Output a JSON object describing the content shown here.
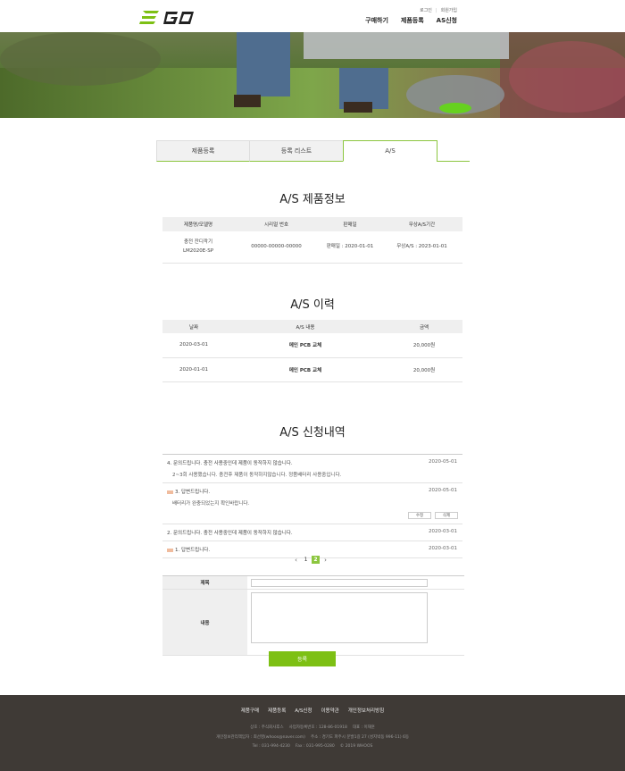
{
  "header": {
    "logo_text": "EGO",
    "util": {
      "login": "로그인",
      "join": "회원가입"
    },
    "nav": [
      "구매하기",
      "제품등록",
      "AS신청"
    ]
  },
  "colors": {
    "accent": "#8cc63f",
    "button": "#7dc014",
    "footer_bg": "#3f3a36"
  },
  "tabs": [
    "제품등록",
    "등록 리스트",
    "A/S"
  ],
  "product_info": {
    "title": "A/S 제품정보",
    "headers": [
      "제품명/모델명",
      "시리얼 번호",
      "판매일",
      "무상A/S기간"
    ],
    "row": {
      "name": "충전 잔디깍기",
      "model": "LM2020E-SP",
      "serial": "00000-00000-00000",
      "sale_date": "판매일 : 2020-01-01",
      "warranty": "무상A/S : 2023-01-01"
    }
  },
  "history": {
    "title": "A/S 이력",
    "headers": [
      "날짜",
      "A/S 내용",
      "금액"
    ],
    "rows": [
      {
        "date": "2020-03-01",
        "content": "메인 PCB 교체",
        "amount": "20,000원"
      },
      {
        "date": "2020-01-01",
        "content": "메인 PCB 교체",
        "amount": "20,000원"
      }
    ]
  },
  "requests": {
    "title": "A/S 신청내역",
    "items": [
      {
        "title": "4. 문의드립니다. 충전 사용중인데 제품이 동작하지 않습니다.",
        "date": "2020-05-01",
        "body": "2~3회 사용했습니다. 충전후 제품이 동작하지않습니다. 정품배터리 사용중입니다."
      },
      {
        "title": "3. 답변드립니다.",
        "date": "2020-05-01",
        "body": "배터리가 완충되었는지 확인바랍니다.",
        "edit": "수정",
        "delete": "삭제"
      },
      {
        "title": "2. 문의드립니다. 충전 사용중인데 제품이 동작하지 않습니다.",
        "date": "2020-03-01"
      },
      {
        "title": "1. 답변드립니다.",
        "date": "2020-03-01"
      }
    ],
    "pages": [
      "1",
      "2"
    ],
    "current_page": "2"
  },
  "form": {
    "title_label": "제목",
    "content_label": "내용",
    "submit": "등록"
  },
  "footer": {
    "nav": [
      "제품구매",
      "제품등록",
      "A/S신청",
      "이용약관",
      "개인정보처리방침"
    ],
    "line1": [
      "상호 : 주식회사후스",
      "사업자등록번호 : 128-86-01918",
      "대표 : 이재훈"
    ],
    "line2": [
      "개인정보관리책임자 : 최선영(whoos@naver.com)",
      "주소 : 경기도 파주시 문발1길 27 (성지박동 996-11) 6동"
    ],
    "line3": [
      "Tel : 031-994-4230",
      "Fax : 031-995-0280",
      "© 2019 WHOOS"
    ]
  }
}
